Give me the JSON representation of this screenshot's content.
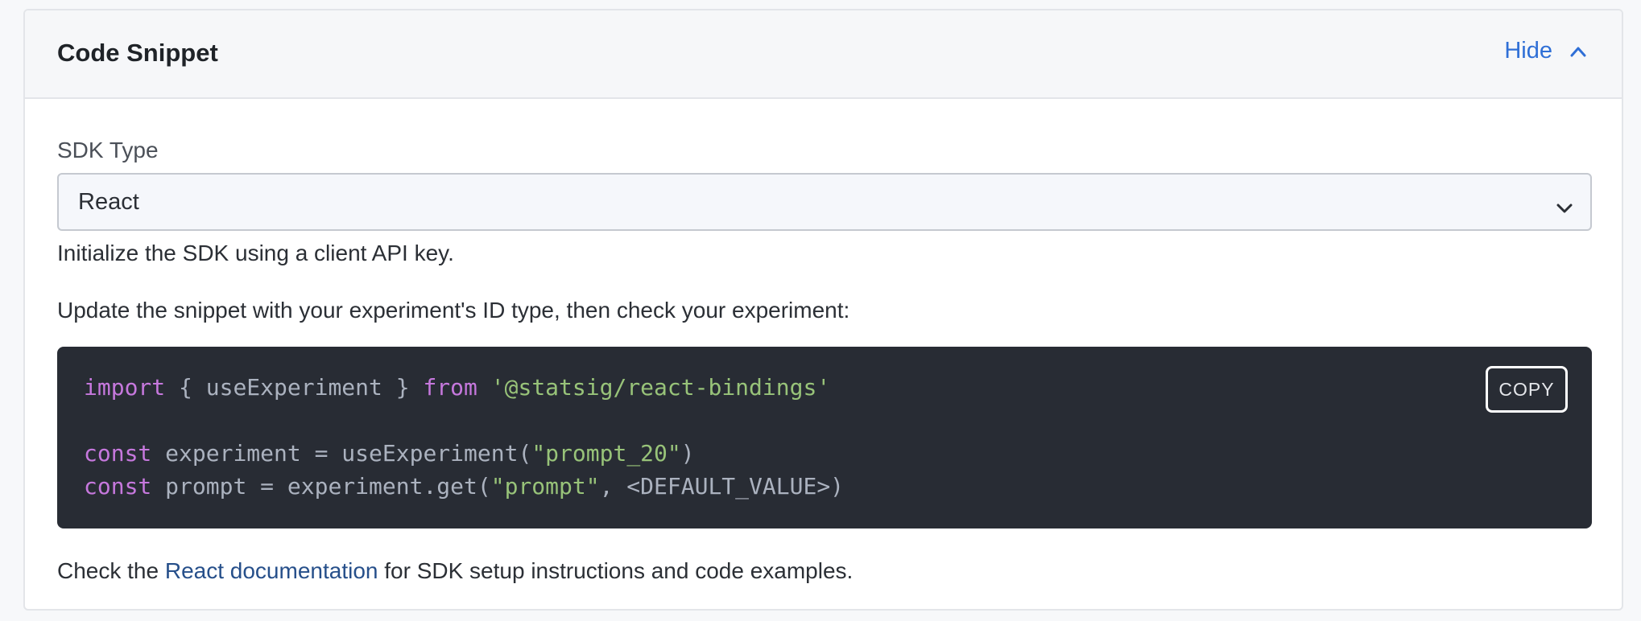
{
  "header": {
    "title": "Code Snippet",
    "hide_label": "Hide"
  },
  "sdk": {
    "label": "SDK Type",
    "selected": "React"
  },
  "descriptions": {
    "line1": "Initialize the SDK using a client API key.",
    "line2": "Update the snippet with your experiment's ID type, then check your experiment:"
  },
  "code": {
    "copy_label": "COPY",
    "line1": {
      "kw1": "import",
      "mid": " { useExperiment } ",
      "kw2": "from",
      "space": " ",
      "str": "'@statsig/react-bindings'"
    },
    "line3": {
      "kw": "const",
      "mid": " experiment = useExperiment(",
      "str": "\"prompt_20\"",
      "end": ")"
    },
    "line4": {
      "kw": "const",
      "mid": " prompt = experiment.get(",
      "str": "\"prompt\"",
      "end": ", <DEFAULT_VALUE>)"
    }
  },
  "footer": {
    "prefix": "Check the ",
    "link": "React documentation",
    "suffix": " for SDK setup instructions and code examples."
  },
  "colors": {
    "link": "#2f6fd6",
    "code_bg": "#282c34",
    "keyword": "#c678dd",
    "string": "#98c379"
  }
}
